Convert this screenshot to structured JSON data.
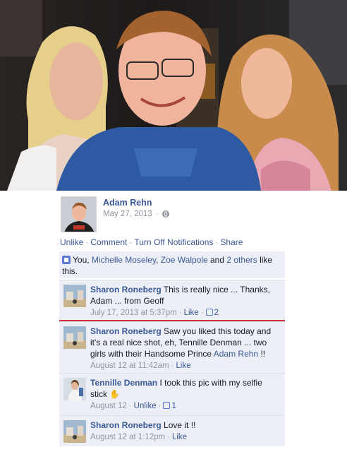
{
  "post": {
    "author": "Adam Rehn",
    "date": "May 27, 2013",
    "privacy_icon": "globe-icon"
  },
  "actions": {
    "unlike": "Unlike",
    "comment": "Comment",
    "turn_off": "Turn Off Notifications",
    "share": "Share",
    "separator": "·"
  },
  "likes": {
    "prefix": "You, ",
    "person1": "Michelle Moseley",
    "sep1": ", ",
    "person2": "Zoe Walpole",
    "and": " and ",
    "others": "2 others",
    "suffix": " like this."
  },
  "comments": [
    {
      "name": "Sharon Roneberg",
      "text": " This is really nice ... Thanks, Adam ... from Geoff",
      "time": "July 17, 2013 at 5:37pm",
      "like": "Like",
      "likes": "2"
    },
    {
      "name": "Sharon Roneberg",
      "text": " Saw you liked this today and it's a real nice shot, eh, Tennille Denman ... two girls with their Handsome Prince ",
      "mention": "Adam Rehn",
      "after": " !!",
      "time": "August 12 at 11:42am",
      "like": "Like"
    },
    {
      "name": "Tennille Denman",
      "text": " I took this pic with my selfie stick ",
      "time": "August 12",
      "unlike": "Unlike",
      "likes": "1"
    },
    {
      "name": "Sharon Roneberg",
      "text": " Love it !!",
      "time": "August 12 at 1:12pm",
      "like": "Like"
    }
  ],
  "colors": {
    "link": "#3b5998",
    "ufi_bg": "#eceff5",
    "muted": "#90949c",
    "divider": "#d0303a"
  }
}
